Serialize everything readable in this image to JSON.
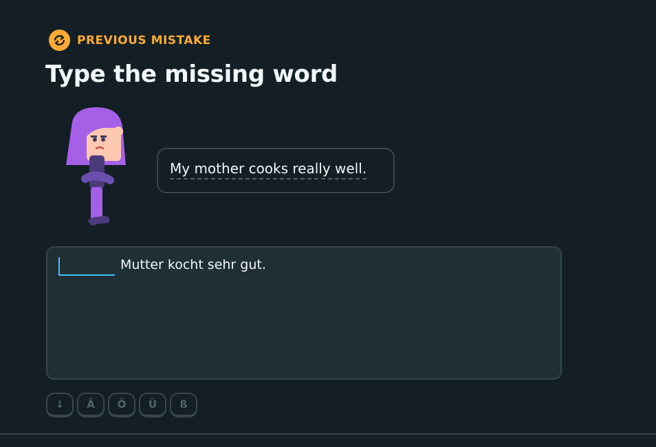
{
  "header": {
    "label": "PREVIOUS MISTAKE",
    "icon": "refresh-icon",
    "color": "#ffab33"
  },
  "title": "Type the missing word",
  "speech": {
    "text": "My mother cooks really well."
  },
  "answer": {
    "blank_value": "",
    "sentence_rest": "Mutter kocht sehr gut."
  },
  "keyboard": {
    "keys": [
      "↓",
      "Ä",
      "Ö",
      "Ü",
      "ß"
    ]
  },
  "colors": {
    "background": "#131f24",
    "accent": "#ffab33",
    "input_border": "#49c0f8",
    "character": "#a560e8"
  }
}
